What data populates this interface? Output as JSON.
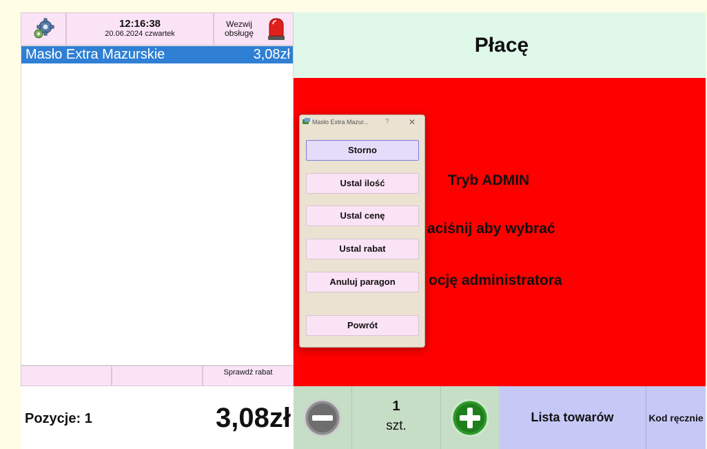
{
  "header": {
    "time": "12:16:38",
    "date": "20.06.2024 czwartek",
    "call_service": "Wezwij obsługę"
  },
  "receipt": {
    "items": [
      {
        "name": "Masło Extra Mazurskie",
        "price": "3,08zł"
      }
    ]
  },
  "bottom_left": {
    "button_1": "",
    "button_2": "",
    "check_discount": "Sprawdź rabat"
  },
  "totals": {
    "positions": "Pozycje: 1",
    "total": "3,08zł"
  },
  "right": {
    "pay": "Płacę",
    "admin_line_1": "Tryb ADMIN",
    "admin_line_2": "aciśnij aby wybrać",
    "admin_line_3": "ocję administratora"
  },
  "quantity": {
    "value": "1",
    "unit": "szt."
  },
  "bottom_right": {
    "product_list": "Lista towarów",
    "manual_code": "Kod ręcznie"
  },
  "dialog": {
    "title": "Masło Extra Mazur...",
    "help": "?",
    "close": "✕",
    "buttons": {
      "storno": "Storno",
      "set_quantity": "Ustal ilość",
      "set_price": "Ustal cenę",
      "set_discount": "Ustal rabat",
      "cancel_receipt": "Anuluj paragon",
      "back": "Powrót"
    }
  },
  "colors": {
    "selected_row": "#2f7fd4",
    "admin_background": "#ff0000",
    "pay_background": "#dff8ea",
    "pink_button": "#fbe3f6"
  }
}
